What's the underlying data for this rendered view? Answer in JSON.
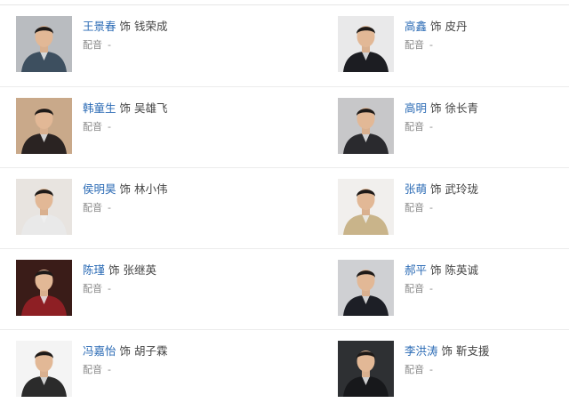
{
  "cast": [
    [
      {
        "actor": "王景春",
        "as": "饰",
        "role": "钱荣成",
        "dub_label": "配音",
        "dub_value": "-",
        "photo_bg": "#b9bcc0",
        "suit": "#3d4f5f"
      },
      {
        "actor": "高鑫",
        "as": "饰",
        "role": "皮丹",
        "dub_label": "配音",
        "dub_value": "-",
        "photo_bg": "#e9e9ea",
        "suit": "#1c1d22"
      }
    ],
    [
      {
        "actor": "韩童生",
        "as": "饰",
        "role": "吴雄飞",
        "dub_label": "配音",
        "dub_value": "-",
        "photo_bg": "#c9a98a",
        "suit": "#2a2322"
      },
      {
        "actor": "高明",
        "as": "饰",
        "role": "徐长青",
        "dub_label": "配音",
        "dub_value": "-",
        "photo_bg": "#c7c7c9",
        "suit": "#2a2a2e"
      }
    ],
    [
      {
        "actor": "侯明昊",
        "as": "饰",
        "role": "林小伟",
        "dub_label": "配音",
        "dub_value": "-",
        "photo_bg": "#e8e4e0",
        "suit": "#e9e9e9"
      },
      {
        "actor": "张萌",
        "as": "饰",
        "role": "武玲珑",
        "dub_label": "配音",
        "dub_value": "-",
        "photo_bg": "#f1efed",
        "suit": "#c9b48a"
      }
    ],
    [
      {
        "actor": "陈瑾",
        "as": "饰",
        "role": "张继英",
        "dub_label": "配音",
        "dub_value": "-",
        "photo_bg": "#3a1c18",
        "suit": "#8e1f24"
      },
      {
        "actor": "郝平",
        "as": "饰",
        "role": "陈英诚",
        "dub_label": "配音",
        "dub_value": "-",
        "photo_bg": "#cfd0d3",
        "suit": "#1d1f26"
      }
    ],
    [
      {
        "actor": "冯嘉怡",
        "as": "饰",
        "role": "胡子霖",
        "dub_label": "配音",
        "dub_value": "-",
        "photo_bg": "#f4f4f4",
        "suit": "#2b2b2b"
      },
      {
        "actor": "李洪涛",
        "as": "饰",
        "role": "靳支援",
        "dub_label": "配音",
        "dub_value": "-",
        "photo_bg": "#2e3033",
        "suit": "#17181b"
      }
    ]
  ]
}
